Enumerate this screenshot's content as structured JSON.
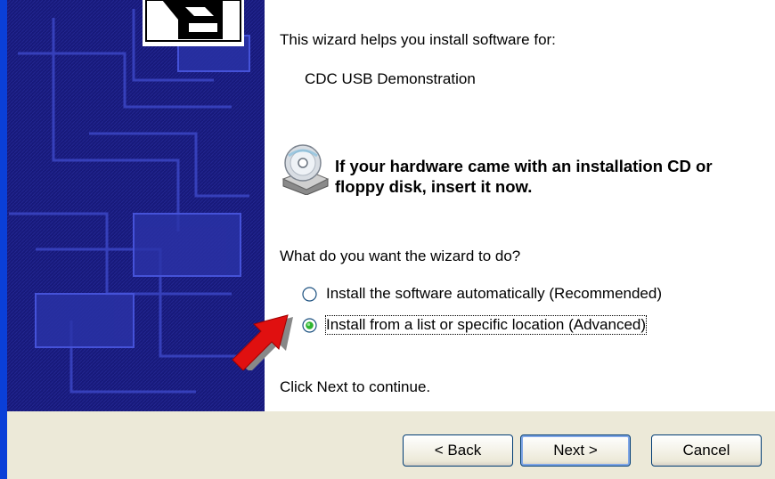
{
  "content": {
    "intro": "This wizard helps you install software for:",
    "device_name": "CDC USB Demonstration",
    "cd_prompt": "If your hardware came with an installation CD or floppy disk, insert it now.",
    "question": "What do you want the wizard to do?",
    "options": [
      {
        "label": "Install the software automatically (Recommended)",
        "selected": false
      },
      {
        "label": "Install from a list or specific location (Advanced)",
        "selected": true
      }
    ],
    "continue_text": "Click Next to continue."
  },
  "buttons": {
    "back": "< Back",
    "next": "Next >",
    "cancel": "Cancel"
  },
  "icons": {
    "cd": "cd-drive-icon",
    "annotation": "red-arrow-icon",
    "header_graphic": "hardware-box-icon"
  },
  "colors": {
    "sidebar": "#17197a",
    "footer": "#ece9d8",
    "accent": "#0a3fd8",
    "arrow": "#e01010"
  }
}
